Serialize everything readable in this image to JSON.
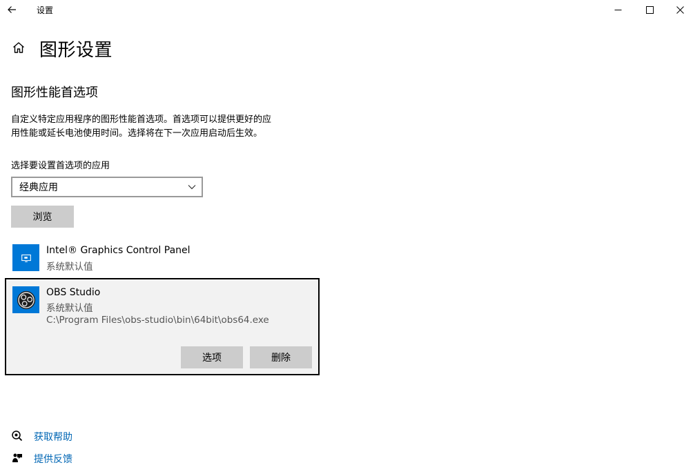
{
  "window": {
    "title": "设置",
    "icons": {
      "back": "back-arrow-icon",
      "minimize": "minimize-icon",
      "maximize": "maximize-icon",
      "close": "close-icon"
    }
  },
  "header": {
    "home_icon": "home-icon",
    "title": "图形设置"
  },
  "section": {
    "title": "图形性能首选项",
    "description_line1": "自定义特定应用程序的图形性能首选项。首选项可以提供更好的应",
    "description_line2": "用性能或延长电池使用时间。选择将在下一次应用启动后生效。"
  },
  "selector": {
    "label": "选择要设置首选项的应用",
    "selected": "经典应用",
    "browse_label": "浏览"
  },
  "apps": [
    {
      "name": "Intel® Graphics Control Panel",
      "preference": "系统默认值",
      "icon": "intel-graphics-icon"
    },
    {
      "name": "OBS Studio",
      "preference": "系统默认值",
      "path": "C:\\Program Files\\obs-studio\\bin\\64bit\\obs64.exe",
      "icon": "obs-studio-icon",
      "options_label": "选项",
      "delete_label": "删除"
    }
  ],
  "footer": {
    "help_label": "获取帮助",
    "feedback_label": "提供反馈"
  },
  "colors": {
    "accent": "#0078d7",
    "link": "#0066b4",
    "button_bg": "#cccccc",
    "selected_bg": "#f2f2f2"
  }
}
